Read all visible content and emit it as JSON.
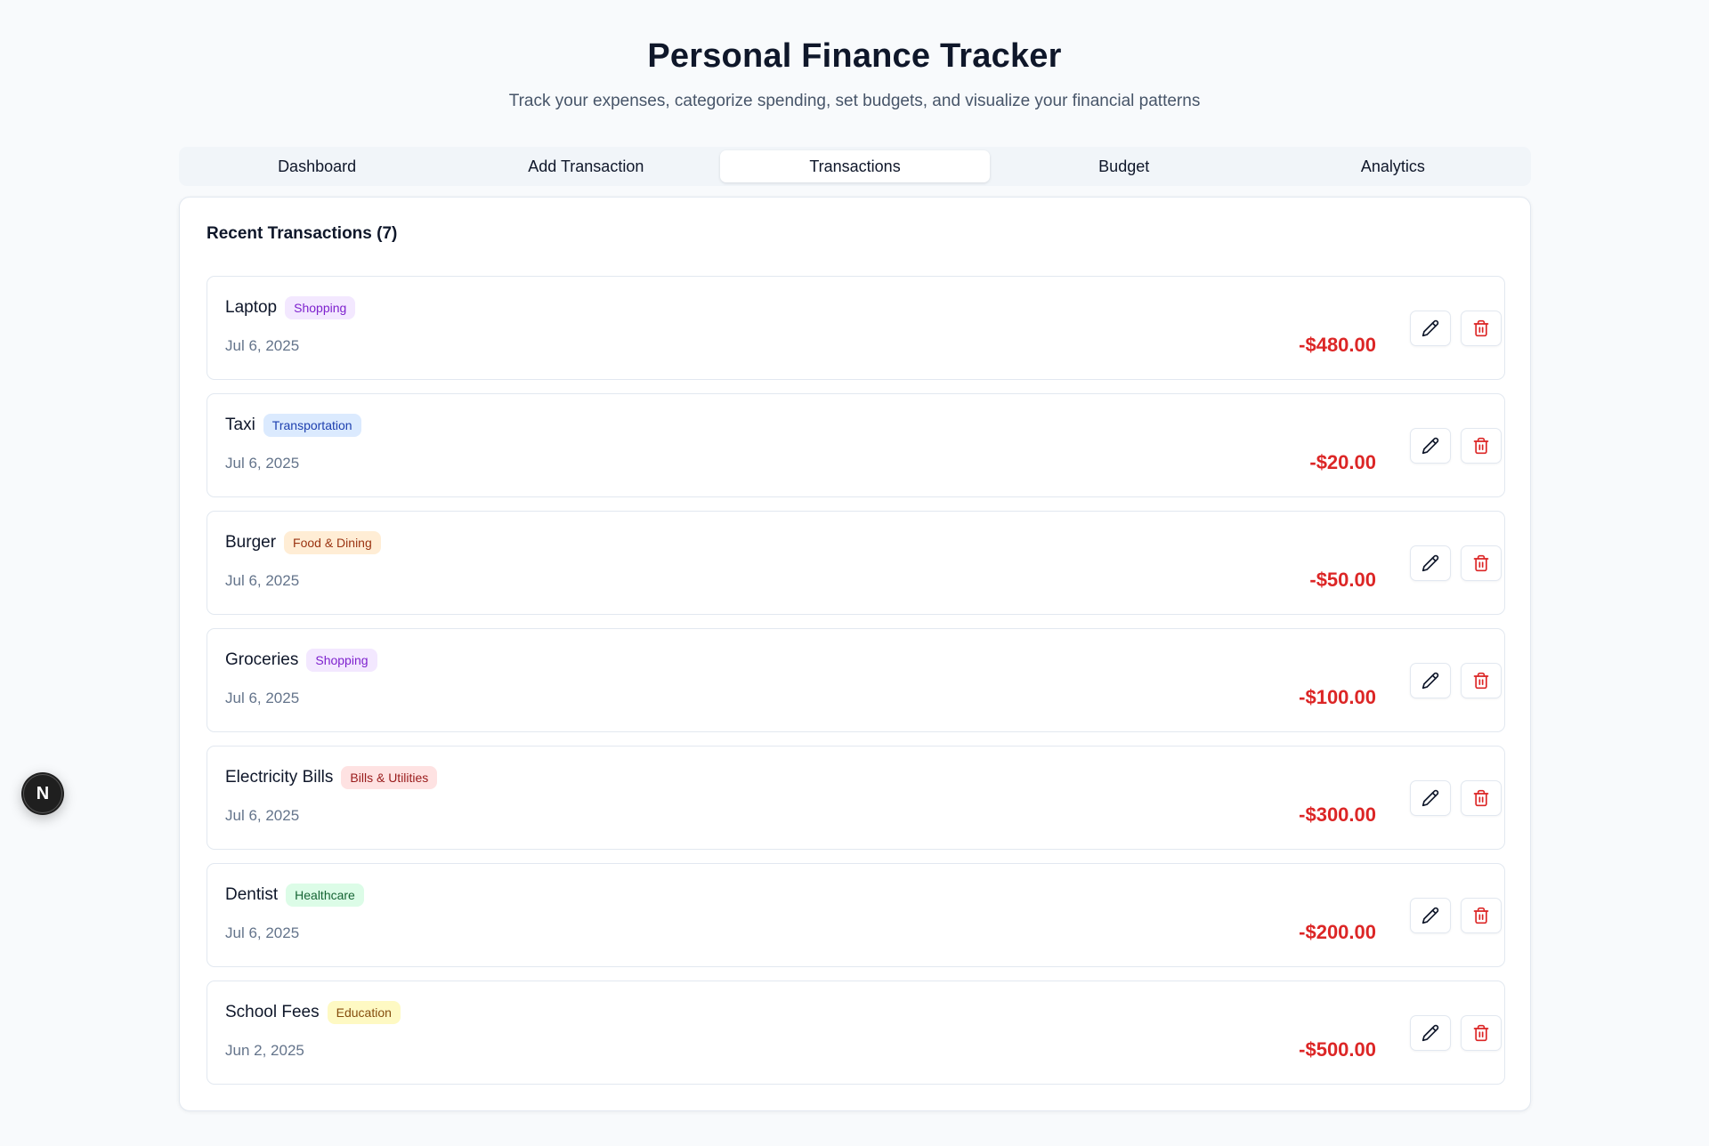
{
  "header": {
    "title": "Personal Finance Tracker",
    "subtitle": "Track your expenses, categorize spending, set budgets, and visualize your financial patterns"
  },
  "tabs": [
    {
      "label": "Dashboard",
      "active": false
    },
    {
      "label": "Add Transaction",
      "active": false
    },
    {
      "label": "Transactions",
      "active": true
    },
    {
      "label": "Budget",
      "active": false
    },
    {
      "label": "Analytics",
      "active": false
    }
  ],
  "transactions_panel": {
    "title": "Recent Transactions (7)",
    "items": [
      {
        "name": "Laptop",
        "category": "Shopping",
        "category_bg": "#f3e8ff",
        "category_fg": "#7e22ce",
        "date": "Jul 6, 2025",
        "amount": "-$480.00"
      },
      {
        "name": "Taxi",
        "category": "Transportation",
        "category_bg": "#dbeafe",
        "category_fg": "#1e40af",
        "date": "Jul 6, 2025",
        "amount": "-$20.00"
      },
      {
        "name": "Burger",
        "category": "Food & Dining",
        "category_bg": "#ffedd5",
        "category_fg": "#9a3412",
        "date": "Jul 6, 2025",
        "amount": "-$50.00"
      },
      {
        "name": "Groceries",
        "category": "Shopping",
        "category_bg": "#f3e8ff",
        "category_fg": "#7e22ce",
        "date": "Jul 6, 2025",
        "amount": "-$100.00"
      },
      {
        "name": "Electricity Bills",
        "category": "Bills & Utilities",
        "category_bg": "#fee2e2",
        "category_fg": "#991b1b",
        "date": "Jul 6, 2025",
        "amount": "-$300.00"
      },
      {
        "name": "Dentist",
        "category": "Healthcare",
        "category_bg": "#dcfce7",
        "category_fg": "#166534",
        "date": "Jul 6, 2025",
        "amount": "-$200.00"
      },
      {
        "name": "School Fees",
        "category": "Education",
        "category_bg": "#fef9c3",
        "category_fg": "#854d0e",
        "date": "Jun 2, 2025",
        "amount": "-$500.00"
      }
    ],
    "edit_icon": "pencil-icon",
    "delete_icon": "trash-icon"
  },
  "dev_badge": {
    "letter": "N"
  },
  "colors": {
    "amount": "#dc2626",
    "delete_icon": "#dc2626",
    "active_tab_bg": "#ffffff"
  }
}
